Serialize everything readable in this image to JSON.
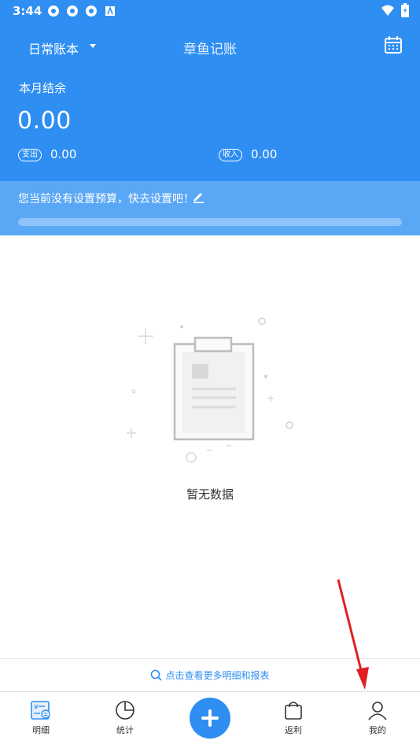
{
  "status_bar": {
    "time": "3:44"
  },
  "header": {
    "book_name": "日常账本",
    "app_title": "章鱼记账"
  },
  "summary": {
    "balance_label": "本月结余",
    "balance_value": "0.00",
    "expense_label": "支出",
    "expense_value": "0.00",
    "income_label": "收入",
    "income_value": "0.00"
  },
  "budget": {
    "message": "您当前没有设置预算，快去设置吧！",
    "progress": 0
  },
  "empty_state": {
    "text": "暂无数据"
  },
  "more_link": {
    "label": "点击查看更多明细和报表"
  },
  "nav": {
    "items": [
      {
        "label": "明细"
      },
      {
        "label": "统计"
      },
      {
        "label": "返利"
      },
      {
        "label": "我的"
      }
    ]
  },
  "colors": {
    "primary": "#2e8ef2",
    "budget_band": "#5aa7f5"
  }
}
